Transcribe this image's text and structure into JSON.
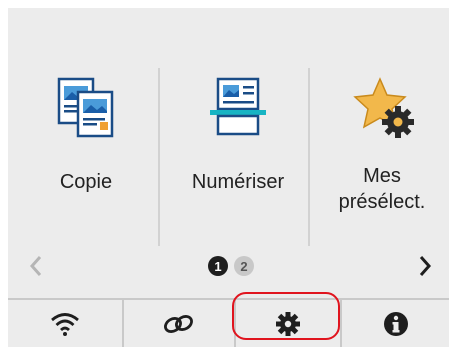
{
  "tiles": [
    {
      "label": "Copie",
      "icon": "copy-icon"
    },
    {
      "label": "Numériser",
      "icon": "scan-icon"
    },
    {
      "label_line1": "Mes",
      "label_line2": "présélect.",
      "icon": "my-presets-star-gear-icon"
    }
  ],
  "pager": {
    "current": "1",
    "next": "2"
  },
  "bottom_bar": {
    "items": [
      "wifi-icon",
      "link-icon",
      "settings-gear-icon",
      "info-icon"
    ]
  },
  "colors": {
    "screen_bg": "#ececec",
    "highlight": "#e0141e",
    "star": "#f2b84b"
  }
}
